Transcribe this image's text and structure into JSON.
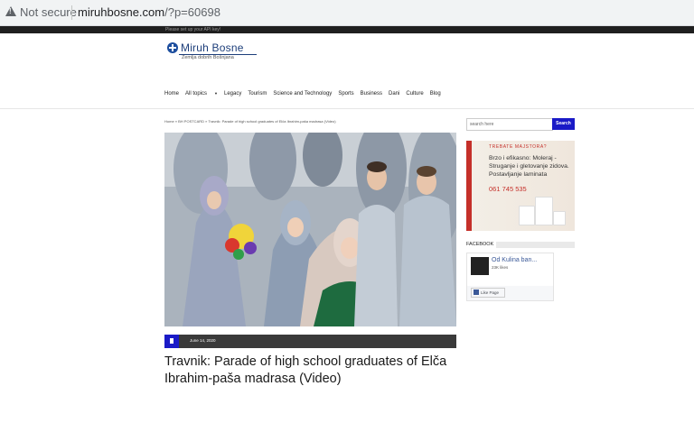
{
  "browser": {
    "security_label": "Not secure",
    "url_host": "miruhbosne.com",
    "url_path": "/?p=60698"
  },
  "topbar": {
    "notice": "Please set up your API key!"
  },
  "logo": {
    "name": "Miruh Bosne",
    "tagline": "Zemlja dobrih Bošnjana"
  },
  "nav": {
    "items": [
      "Home",
      "All topics",
      "Legacy",
      "Tourism",
      "Science and Technology",
      "Sports",
      "Business",
      "Dani",
      "Culture",
      "Blog"
    ]
  },
  "breadcrumb": "Home  »  BH POSTCARD  »  Travnik: Parade of high school graduates of Elča Ibrahim-paša madrasa (Video)",
  "article": {
    "date": "June 14, 2020",
    "title": "Travnik: Parade of high school graduates of Elča Ibrahim-paša madrasa (Video)"
  },
  "sidebar": {
    "search_placeholder": "search here",
    "search_button": "Search",
    "ad": {
      "heading": "TREBATE MAJSTORA?",
      "body": "Brzo i efikasno: Moleraj - Struganje i gletovanje zidova. Postavljanje laminata",
      "phone": "061 745 535"
    },
    "facebook": {
      "heading": "FACEBOOK",
      "page_name": "Od Kulina ban...",
      "likes": "23K likes",
      "like_button": "Like Page"
    }
  },
  "colors": {
    "accent": "#1a1ac7",
    "brand": "#1d3e7a",
    "ad_red": "#c5302a"
  },
  "icons": [
    "warning-icon",
    "post-icon",
    "facebook-like-icon"
  ]
}
